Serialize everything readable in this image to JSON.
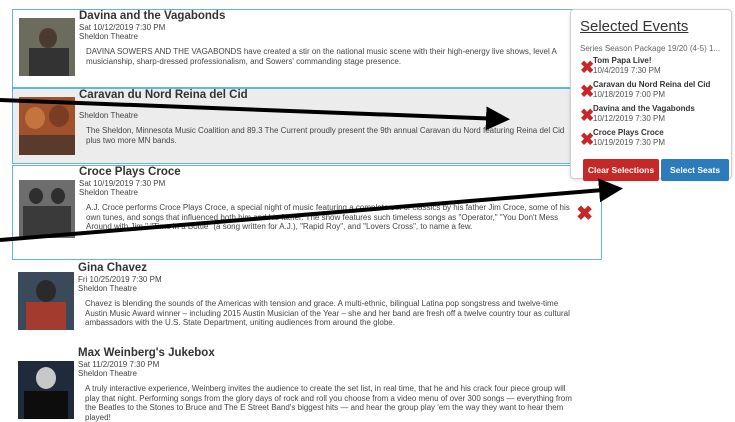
{
  "events": [
    {
      "title": "Davina and the Vagabonds",
      "date": "Sat 10/12/2019 7:30 PM",
      "venue": "Sheldon Theatre",
      "description": "DAVINA SOWERS AND THE VAGABONDS have created a stir on the national music scene with their high-energy live shows, level A musicianship, sharp-dressed professionalism, and Sowers' commanding stage presence."
    },
    {
      "title": "Caravan du Nord Reina del Cid",
      "date": "",
      "venue": "Sheldon Theatre",
      "description": "The Sheldon, Minnesota Music Coalition and 89.3 The Current proudly present the 9th annual Caravan du Nord featuring Reina del Cid plus two more MN bands."
    },
    {
      "title": "Croce Plays Croce",
      "date": "Sat 10/19/2019 7:30 PM",
      "venue": "Sheldon Theatre",
      "description": "A.J. Croce performs Croce Plays Croce, a special night of music featuring a complete set of classics by his father Jim Croce, some of his own tunes, and songs that influenced both him and his father. The show features such timeless songs as \"Operator,\" \"You Don't Mess Around with Jim,\" \"Time in a Bottle\" (a song written for A.J.), \"Rapid Roy\", and \"Lovers Cross\", to name a few."
    },
    {
      "title": "Gina Chavez",
      "date": "Fri 10/25/2019 7:30 PM",
      "venue": "Sheldon Theatre",
      "description": "Chavez is blending the sounds of the Americas with tension and grace. A multi-ethnic, bilingual Latina pop songstress and twelve-time Austin Music Award winner – including 2015 Austin Musician of the Year – she and her band are fresh off a twelve country tour as cultural ambassadors with the U.S. State Department, uniting audiences from around the globe."
    },
    {
      "title": "Max Weinberg's Jukebox",
      "date": "Sat 11/2/2019 7:30 PM",
      "venue": "Sheldon Theatre",
      "description": "A truly interactive experience, Weinberg invites the audience to create the set list, in real time, that he and his crack four piece group will play that night. Performing songs from the glory days of rock and roll you choose from a video menu of over 300 songs — everything from the Beatles to the Stones to Bruce and The E Street Band's biggest hits — and hear the group play 'em the way they want to hear them played!"
    }
  ],
  "panel": {
    "title": "Selected Events",
    "package": "Series Season Package 19/20 (4-5) 1...",
    "items": [
      {
        "name": "Tom Papa Live!",
        "date": "10/4/2019 7:30 PM"
      },
      {
        "name": "Caravan du Nord Reina del Cid",
        "date": "10/18/2019 7:00 PM"
      },
      {
        "name": "Davina and the Vagabonds",
        "date": "10/12/2019 7:30 PM"
      },
      {
        "name": "Croce Plays Croce",
        "date": "10/19/2019 7:30 PM"
      }
    ],
    "clear_label": "Clear Selections",
    "seats_label": "Select Seats"
  },
  "colors": {
    "remove": "#c62828",
    "primary": "#2b7bbd",
    "selected_border": "#63b3e8"
  },
  "icons": [
    "remove-x-icon"
  ]
}
